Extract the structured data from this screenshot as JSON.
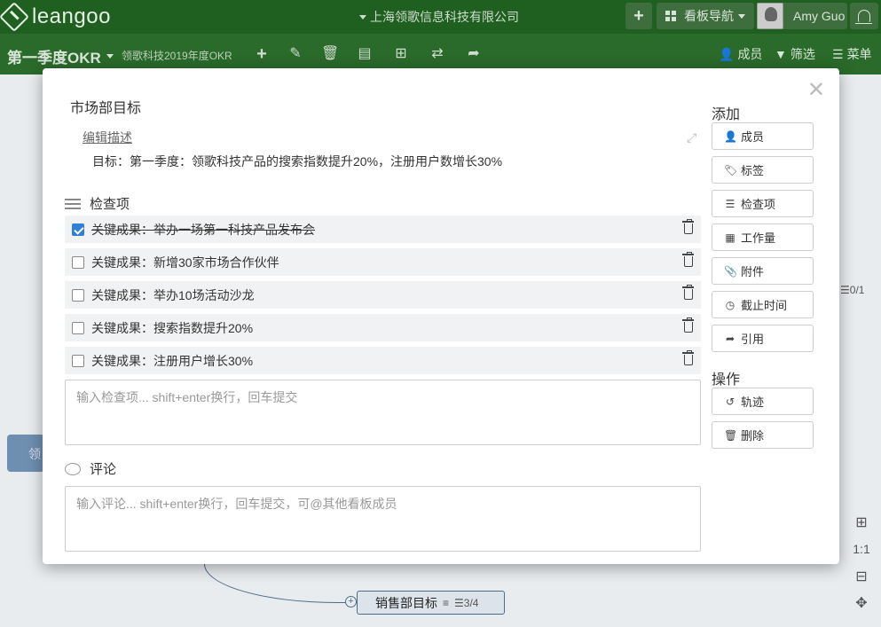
{
  "topbar": {
    "logo_text": "leangoo",
    "company": "上海领歌信息科技有限公司",
    "board_nav": "看板导航",
    "user_name": "Amy Guo"
  },
  "boardbar": {
    "title": "第一季度OKR",
    "subtitle": "领歌科技2019年度OKR",
    "members": "成员",
    "filter": "筛选",
    "menu": "菜单"
  },
  "background": {
    "node_label": "销售部目标",
    "node_meta": "3/4",
    "left_node": "领",
    "side_meta": "0/1",
    "zoom_label": "1:1"
  },
  "modal": {
    "title": "市场部目标",
    "edit_desc": "编辑描述",
    "description": "目标：第一季度：领歌科技产品的搜索指数提升20%，注册用户数增长30%",
    "checklist_title": "检查项",
    "checklist": [
      {
        "label": "关键成果：举办一场第一科技产品发布会",
        "checked": true
      },
      {
        "label": "关键成果：新增30家市场合作伙伴",
        "checked": false
      },
      {
        "label": "关键成果：举办10场活动沙龙",
        "checked": false
      },
      {
        "label": "关键成果：搜索指数提升20%",
        "checked": false
      },
      {
        "label": "关键成果：注册用户增长30%",
        "checked": false
      }
    ],
    "checklist_placeholder": "输入检查项... shift+enter换行，回车提交",
    "comment_title": "评论",
    "comment_placeholder": "输入评论... shift+enter换行，回车提交，可@其他看板成员",
    "add_title": "添加",
    "add_buttons": [
      "成员",
      "标签",
      "检查项",
      "工作量",
      "附件",
      "截止时间",
      "引用"
    ],
    "ops_title": "操作",
    "ops_buttons": [
      "轨迹",
      "删除"
    ]
  },
  "colors": {
    "topbar": "#1f5f1f",
    "boardbar": "#2a6a2a",
    "checkbox_checked": "#2d7fd8"
  }
}
